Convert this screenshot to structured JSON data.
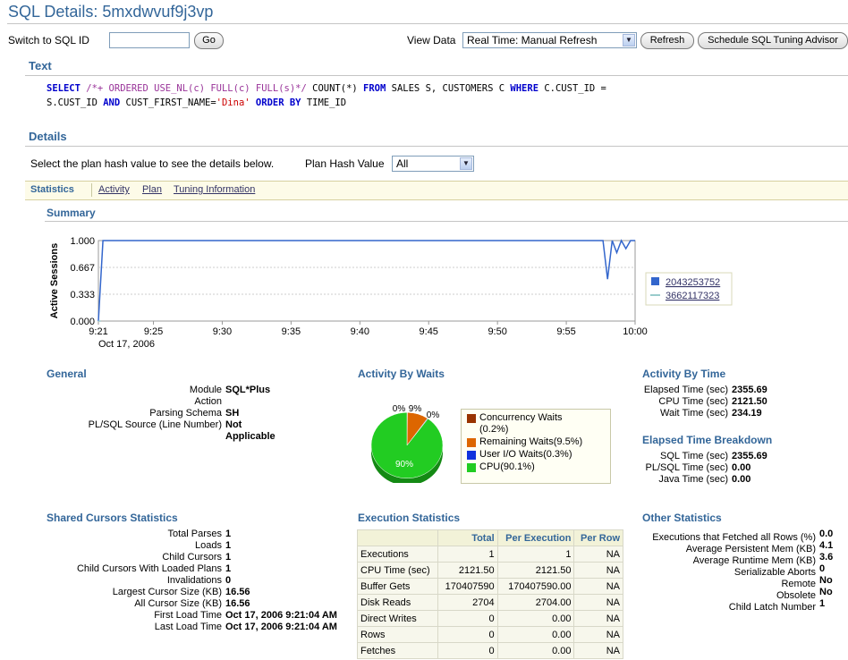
{
  "page": {
    "title": "SQL Details: 5mxdwvuf9j3vp"
  },
  "toolbar": {
    "switch_label": "Switch to SQL ID",
    "switch_value": "",
    "go_label": "Go",
    "view_data_label": "View Data",
    "view_data_value": "Real Time: Manual Refresh",
    "refresh_label": "Refresh",
    "tuning_label": "Schedule SQL Tuning Advisor"
  },
  "text_section": {
    "heading": "Text",
    "sql_line1": [
      {
        "t": "SELECT",
        "c": "kw"
      },
      {
        "t": " ",
        "c": ""
      },
      {
        "t": "/*+ ORDERED USE_NL(c) FULL(c) FULL(s)*/",
        "c": "cmt"
      },
      {
        "t": " COUNT(*) ",
        "c": ""
      },
      {
        "t": "FROM",
        "c": "kw"
      },
      {
        "t": " SALES S, CUSTOMERS C ",
        "c": ""
      },
      {
        "t": "WHERE",
        "c": "kw"
      },
      {
        "t": " C.CUST_ID =",
        "c": ""
      }
    ],
    "sql_line2": [
      {
        "t": "S.CUST_ID ",
        "c": ""
      },
      {
        "t": "AND",
        "c": "kw"
      },
      {
        "t": " CUST_FIRST_NAME=",
        "c": ""
      },
      {
        "t": "'Dina'",
        "c": "str"
      },
      {
        "t": " ",
        "c": ""
      },
      {
        "t": "ORDER BY",
        "c": "kw"
      },
      {
        "t": " TIME_ID",
        "c": ""
      }
    ]
  },
  "details": {
    "heading": "Details",
    "instruction": "Select the plan hash value to see the details below.",
    "plan_hash_label": "Plan Hash Value",
    "plan_hash_value": "All"
  },
  "tabs": [
    {
      "label": "Statistics",
      "active": true
    },
    {
      "label": "Activity",
      "active": false
    },
    {
      "label": "Plan",
      "active": false
    },
    {
      "label": "Tuning Information",
      "active": false
    }
  ],
  "summary": {
    "heading": "Summary"
  },
  "chart_data": {
    "type": "line",
    "ylabel": "Active Sessions",
    "ylim": [
      0,
      1
    ],
    "yticks": [
      "1.000",
      "0.667",
      "0.333",
      "0.000"
    ],
    "x_ticks": [
      "9:21",
      "9:25",
      "9:30",
      "9:35",
      "9:40",
      "9:45",
      "9:50",
      "9:55",
      "10:00"
    ],
    "x_date": "Oct 17, 2006",
    "grid": true,
    "legend_position": "right",
    "series": [
      {
        "name": "2043253752",
        "color": "#3366cc",
        "x": [
          "9:21:00",
          "9:21:20",
          "9:57:40",
          "9:58:00",
          "9:58:20",
          "9:58:40",
          "9:59:00",
          "9:59:20",
          "9:59:40",
          "10:00:00"
        ],
        "y": [
          0.0,
          1.0,
          1.0,
          0.52,
          1.0,
          0.85,
          1.0,
          0.9,
          1.0,
          1.0
        ]
      },
      {
        "name": "3662117323",
        "color": "#99cccc",
        "x": [
          "9:21:00",
          "9:21:10"
        ],
        "y": [
          0.0,
          0.0
        ]
      }
    ]
  },
  "general": {
    "heading": "General",
    "rows": [
      {
        "k": "Module",
        "v": "SQL*Plus"
      },
      {
        "k": "Action",
        "v": ""
      },
      {
        "k": "Parsing Schema",
        "v": "SH"
      },
      {
        "k": "PL/SQL Source (Line Number)",
        "v": "Not"
      }
    ],
    "continuation": "Applicable"
  },
  "activity_by_waits": {
    "heading": "Activity By Waits",
    "pie_labels": [
      "0%",
      "9%",
      "0%",
      "90%"
    ],
    "pie_data": {
      "type": "pie",
      "slices": [
        {
          "name": "Concurrency Waits",
          "value": 0.2,
          "color": "#993300"
        },
        {
          "name": "Remaining Waits",
          "value": 9.5,
          "color": "#dd6600"
        },
        {
          "name": "User I/O Waits",
          "value": 0.3,
          "color": "#1133dd"
        },
        {
          "name": "CPU",
          "value": 90.1,
          "color": "#22cc22"
        }
      ]
    },
    "legend": [
      {
        "line1": "Concurrency Waits",
        "line2": "(0.2%)",
        "color": "#993300"
      },
      {
        "line1": "Remaining Waits(9.5%)",
        "line2": "",
        "color": "#dd6600"
      },
      {
        "line1": "User I/O Waits(0.3%)",
        "line2": "",
        "color": "#1133dd"
      },
      {
        "line1": "CPU(90.1%)",
        "line2": "",
        "color": "#22cc22"
      }
    ]
  },
  "activity_by_time": {
    "heading": "Activity By Time",
    "rows": [
      {
        "k": "Elapsed Time (sec)",
        "v": "2355.69"
      },
      {
        "k": "CPU Time (sec)",
        "v": "2121.50"
      },
      {
        "k": "Wait Time (sec)",
        "v": "234.19"
      }
    ]
  },
  "elapsed_breakdown": {
    "heading": "Elapsed Time Breakdown",
    "rows": [
      {
        "k": "SQL Time (sec)",
        "v": "2355.69"
      },
      {
        "k": "PL/SQL Time (sec)",
        "v": "0.00"
      },
      {
        "k": "Java Time (sec)",
        "v": "0.00"
      }
    ]
  },
  "shared_cursors": {
    "heading": "Shared Cursors Statistics",
    "rows": [
      {
        "k": "Total Parses",
        "v": "1"
      },
      {
        "k": "Loads",
        "v": "1"
      },
      {
        "k": "Child Cursors",
        "v": "1"
      },
      {
        "k": "Child Cursors With Loaded Plans",
        "v": "1"
      },
      {
        "k": "Invalidations",
        "v": "0"
      },
      {
        "k": "Largest Cursor Size (KB)",
        "v": "16.56"
      },
      {
        "k": "All Cursor Size (KB)",
        "v": "16.56"
      },
      {
        "k": "First Load Time",
        "v": "Oct 17, 2006 9:21:04 AM"
      },
      {
        "k": "Last Load Time",
        "v": "Oct 17, 2006 9:21:04 AM"
      }
    ]
  },
  "execution_stats": {
    "heading": "Execution Statistics",
    "columns": [
      "",
      "Total",
      "Per Execution",
      "Per Row"
    ],
    "rows": [
      [
        "Executions",
        "1",
        "1",
        "NA"
      ],
      [
        "CPU Time (sec)",
        "2121.50",
        "2121.50",
        "NA"
      ],
      [
        "Buffer Gets",
        "170407590",
        "170407590.00",
        "NA"
      ],
      [
        "Disk Reads",
        "2704",
        "2704.00",
        "NA"
      ],
      [
        "Direct Writes",
        "0",
        "0.00",
        "NA"
      ],
      [
        "Rows",
        "0",
        "0.00",
        "NA"
      ],
      [
        "Fetches",
        "0",
        "0.00",
        "NA"
      ]
    ]
  },
  "other_stats": {
    "heading": "Other Statistics",
    "rows": [
      {
        "k": "Executions that Fetched all Rows (%)",
        "v": "0.0"
      },
      {
        "k": "Average Persistent Mem (KB)",
        "v": "4.1"
      },
      {
        "k": "Average Runtime Mem (KB)",
        "v": "3.6"
      },
      {
        "k": "Serializable Aborts",
        "v": "0"
      },
      {
        "k": "Remote",
        "v": "No"
      },
      {
        "k": "Obsolete",
        "v": "No"
      },
      {
        "k": "Child Latch Number",
        "v": "1"
      }
    ]
  }
}
